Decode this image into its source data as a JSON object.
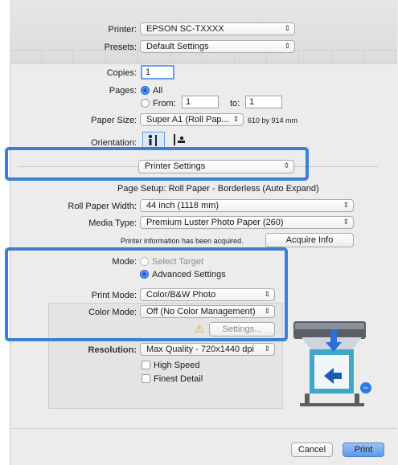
{
  "printer": {
    "label": "Printer:",
    "value": "EPSON SC-TXXXX"
  },
  "presets": {
    "label": "Presets:",
    "value": "Default Settings"
  },
  "copies": {
    "label": "Copies:",
    "value": "1"
  },
  "pages": {
    "label": "Pages:",
    "all": "All",
    "from": "From:",
    "from_value": "1",
    "to": "to:",
    "to_value": "1"
  },
  "paper_size": {
    "label": "Paper Size:",
    "value": "Super A1 (Roll Pap...",
    "dims": "610 by 914 mm"
  },
  "orientation": {
    "label": "Orientation:"
  },
  "panel_select": {
    "value": "Printer Settings"
  },
  "page_setup": "Page Setup: Roll Paper - Borderless (Auto Expand)",
  "roll_width": {
    "label": "Roll Paper Width:",
    "value": "44 inch (1118 mm)"
  },
  "media_type": {
    "label": "Media Type:",
    "value": "Premium Luster Photo Paper (260)"
  },
  "printer_info": "Printer information has been acquired.",
  "acquire_button": "Acquire Info",
  "mode": {
    "label": "Mode:",
    "select_target": "Select Target",
    "advanced": "Advanced Settings"
  },
  "print_mode": {
    "label": "Print Mode:",
    "value": "Color/B&W Photo"
  },
  "color_mode": {
    "label": "Color Mode:",
    "value": "Off (No Color Management)"
  },
  "settings_button": "Settings...",
  "resolution": {
    "label": "Resolution:",
    "value": "Max Quality - 720x1440 dpi"
  },
  "high_speed": "High Speed",
  "finest_detail": "Finest Detail",
  "footer": {
    "cancel": "Cancel",
    "print": "Print"
  },
  "colors": {
    "highlight": "#3d7fd2",
    "accent": "#2b7be0"
  }
}
